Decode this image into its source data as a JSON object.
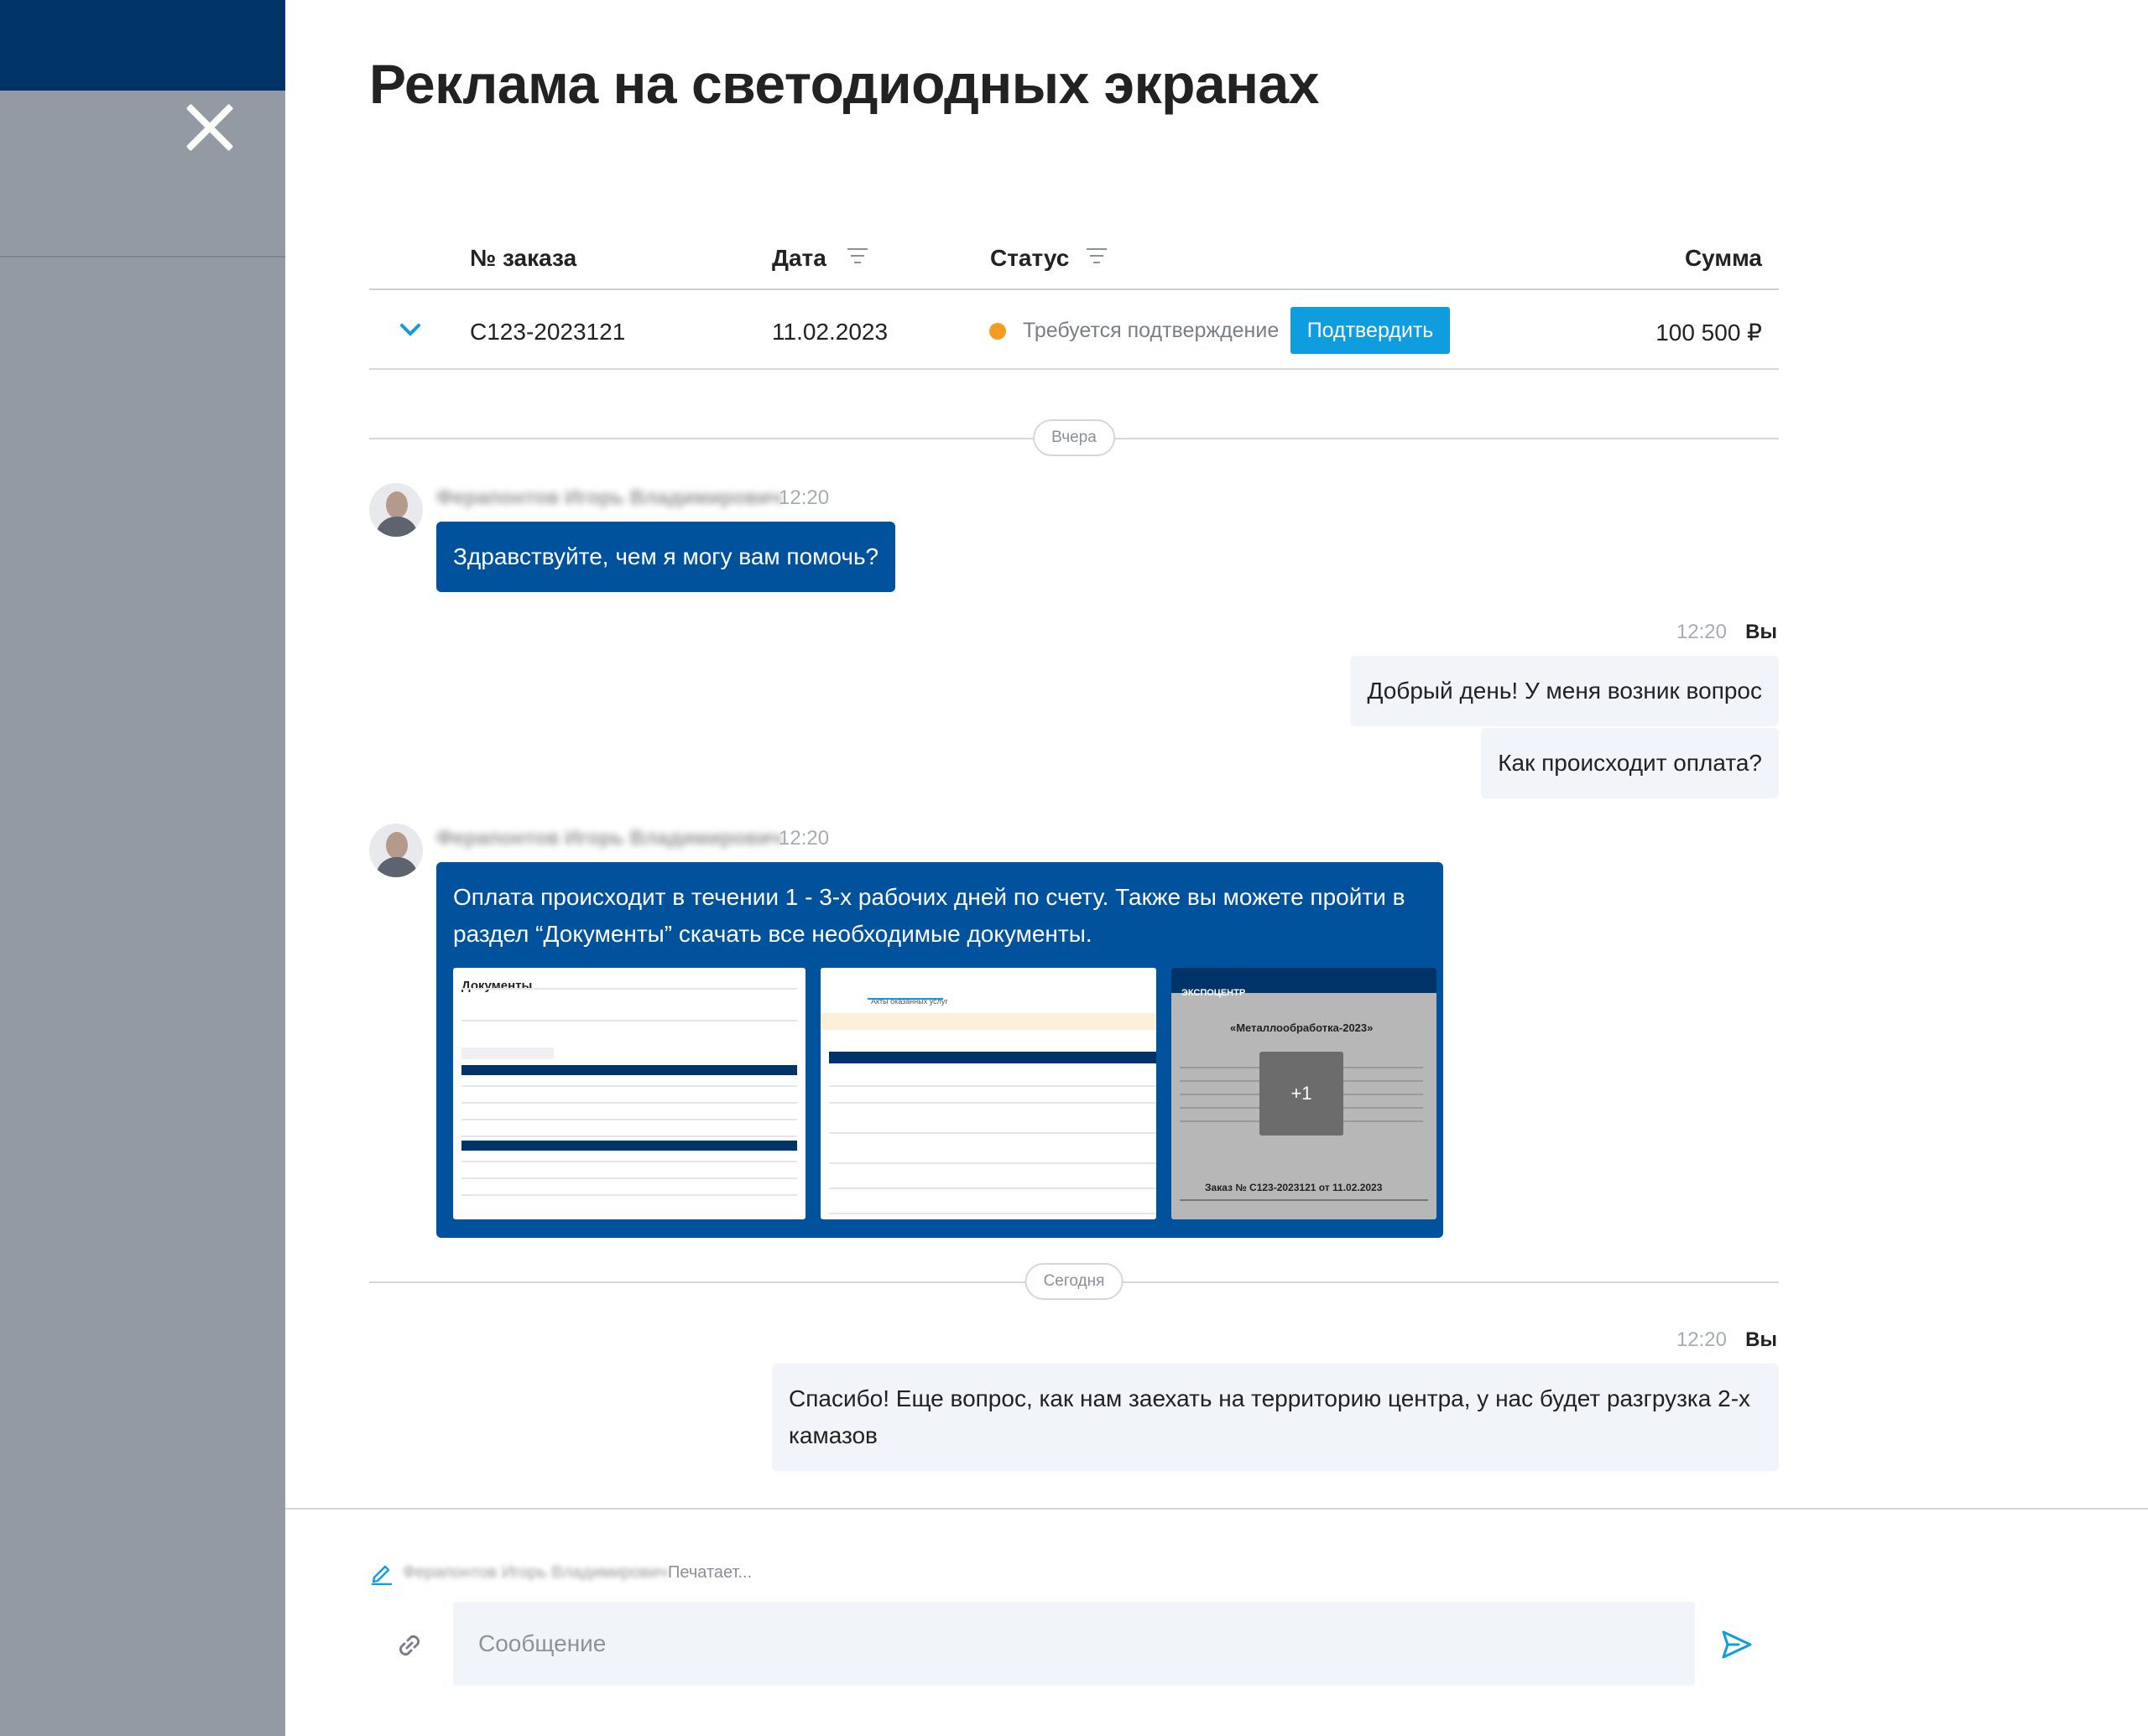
{
  "page": {
    "title": "Реклама на светодиодных экранах"
  },
  "table": {
    "headers": {
      "order_no": "№ заказа",
      "date": "Дата",
      "status": "Статус",
      "sum": "Сумма"
    },
    "row": {
      "order_no": "С123-2023121",
      "date": "11.02.2023",
      "status": "Требуется подтверждение",
      "status_color": "#f39c22",
      "action": "Подтвердить",
      "sum": "100 500 ₽"
    }
  },
  "separators": {
    "yesterday": "Вчера",
    "today": "Сегодня"
  },
  "messages": {
    "m1": {
      "sender": "Ферапонтов Игорь Владимирович",
      "time": "12:20",
      "text": "Здравствуйте, чем я могу вам помочь?"
    },
    "m2": {
      "time": "12:20",
      "you": "Вы",
      "texts": [
        "Добрый день! У меня возник вопрос",
        "Как происходит оплата?"
      ]
    },
    "m3": {
      "sender": "Ферапонтов Игорь Владимирович",
      "time": "12:20",
      "line1": "Оплата происходит в течении 1 - 3-х рабочих дней по счету. Также вы можете пройти в",
      "line2": "раздел “Документы” скачать все необходимые документы.",
      "attachments": {
        "a1_title": "Документы",
        "a2_tab": "Акты оказанных услуг",
        "a3_brand": "ЭКСПОЦЕНТР",
        "a3_event": "«Металлообработка-2023»",
        "a3_order": "Заказ № С123-2023121 от 11.02.2023",
        "more": "+1"
      }
    },
    "m4": {
      "time": "12:20",
      "you": "Вы",
      "line1": "Спасибо! Еще вопрос, как нам заехать на территорию центра, у нас будет разгрузка 2-х",
      "line2": "камазов"
    }
  },
  "composer": {
    "typing_name": "Ферапонтов Игорь Владимирович",
    "typing_text": "Печатает...",
    "placeholder": "Сообщение"
  },
  "colors": {
    "accent": "#0f9de0",
    "bubble_in": "#00529c",
    "bubble_out": "#f1f4f8",
    "topbar": "#003468",
    "overlay": "#949aa3"
  },
  "icons": [
    "close-icon",
    "filter-icon",
    "chevron-down-icon",
    "pencil-icon",
    "link-icon",
    "send-icon"
  ]
}
